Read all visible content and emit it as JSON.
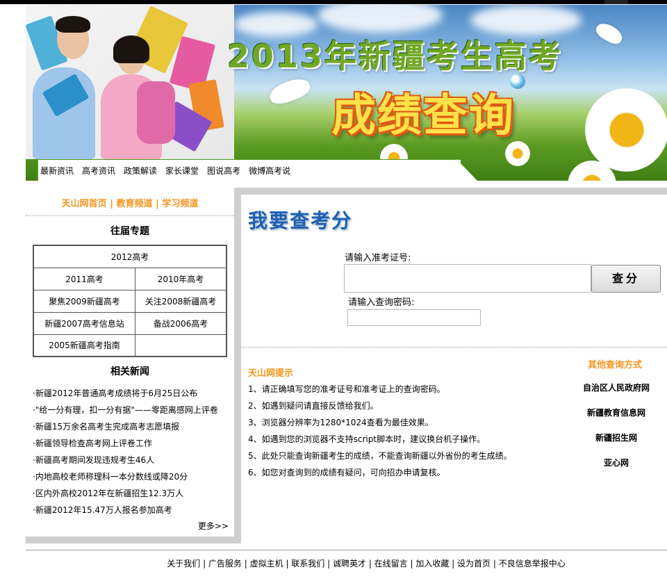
{
  "banner": {
    "title_line1": "2013年新疆考生高考",
    "title_line2": "成绩查询"
  },
  "nav": {
    "items": [
      "最新资讯",
      "高考资讯",
      "政策解读",
      "家长课堂",
      "图说高考",
      "微博高考说"
    ]
  },
  "left": {
    "site_links": [
      "天山网首页",
      "教育频道",
      "学习频道"
    ],
    "site_link_separator": " | ",
    "topics_title": "往届专题",
    "topics": {
      "row0": "2012高考",
      "row1": [
        "2011高考",
        "2010年高考"
      ],
      "row2": [
        "聚焦2009新疆高考",
        "关注2008新疆高考"
      ],
      "row3": [
        "新疆2007高考信息站",
        "备战2006高考"
      ],
      "row4": [
        "2005新疆高考指南",
        ""
      ]
    },
    "news_title": "相关新闻",
    "news": [
      "·新疆2012年普通高考成绩将于6月25日公布",
      "·\"给一分有理，扣一分有据\"——零距离感网上评卷",
      "·新疆15万余名高考生完成高考志愿填报",
      "·新疆领导检查高考网上评卷工作",
      "·新疆高考期间发现违规考生46人",
      "·内地高校老师称理科一本分数线或降20分",
      "·区内外高校2012年在新疆招生12.3万人",
      "·新疆2012年15.47万人报名参加高考"
    ],
    "more": "更多>>"
  },
  "query": {
    "title": "我要查考分",
    "exam_no_label": "请输入准考证号:",
    "exam_no_value": "",
    "password_label": "请输入查询密码:",
    "password_value": "",
    "submit": "查分"
  },
  "tips": {
    "title": "天山网提示",
    "items": [
      "1、请正确填写您的准考证号和准考证上的查询密码。",
      "2、如遇到疑问请直接反馈给我们。",
      "3、浏览器分辨率为1280*1024查看为最佳效果。",
      "4、如遇到您的浏览器不支持script脚本时，建议换台机子操作。",
      "5、此处只能查询新疆考生的成绩，不能查询新疆以外省份的考生成绩。",
      "6、如您对查询到的成绩有疑问，可向招办申请复核。"
    ]
  },
  "other": {
    "title": "其他查询方式",
    "links": [
      "自治区人民政府网",
      "新疆教育信息网",
      "新疆招生网",
      "亚心网"
    ]
  },
  "footer": {
    "links": [
      "关于我们",
      "广告服务",
      "虚拟主机",
      "联系我们",
      "诚聘英才",
      "在线留言",
      "加入收藏",
      "设为首页",
      "不良信息举报中心"
    ],
    "separator": " | "
  },
  "colors": {
    "accent_orange": "#f7941d",
    "title_blue": "#1f5fae",
    "panel_gray": "#cfcfcf",
    "nav_green": "#4c9a1a"
  }
}
